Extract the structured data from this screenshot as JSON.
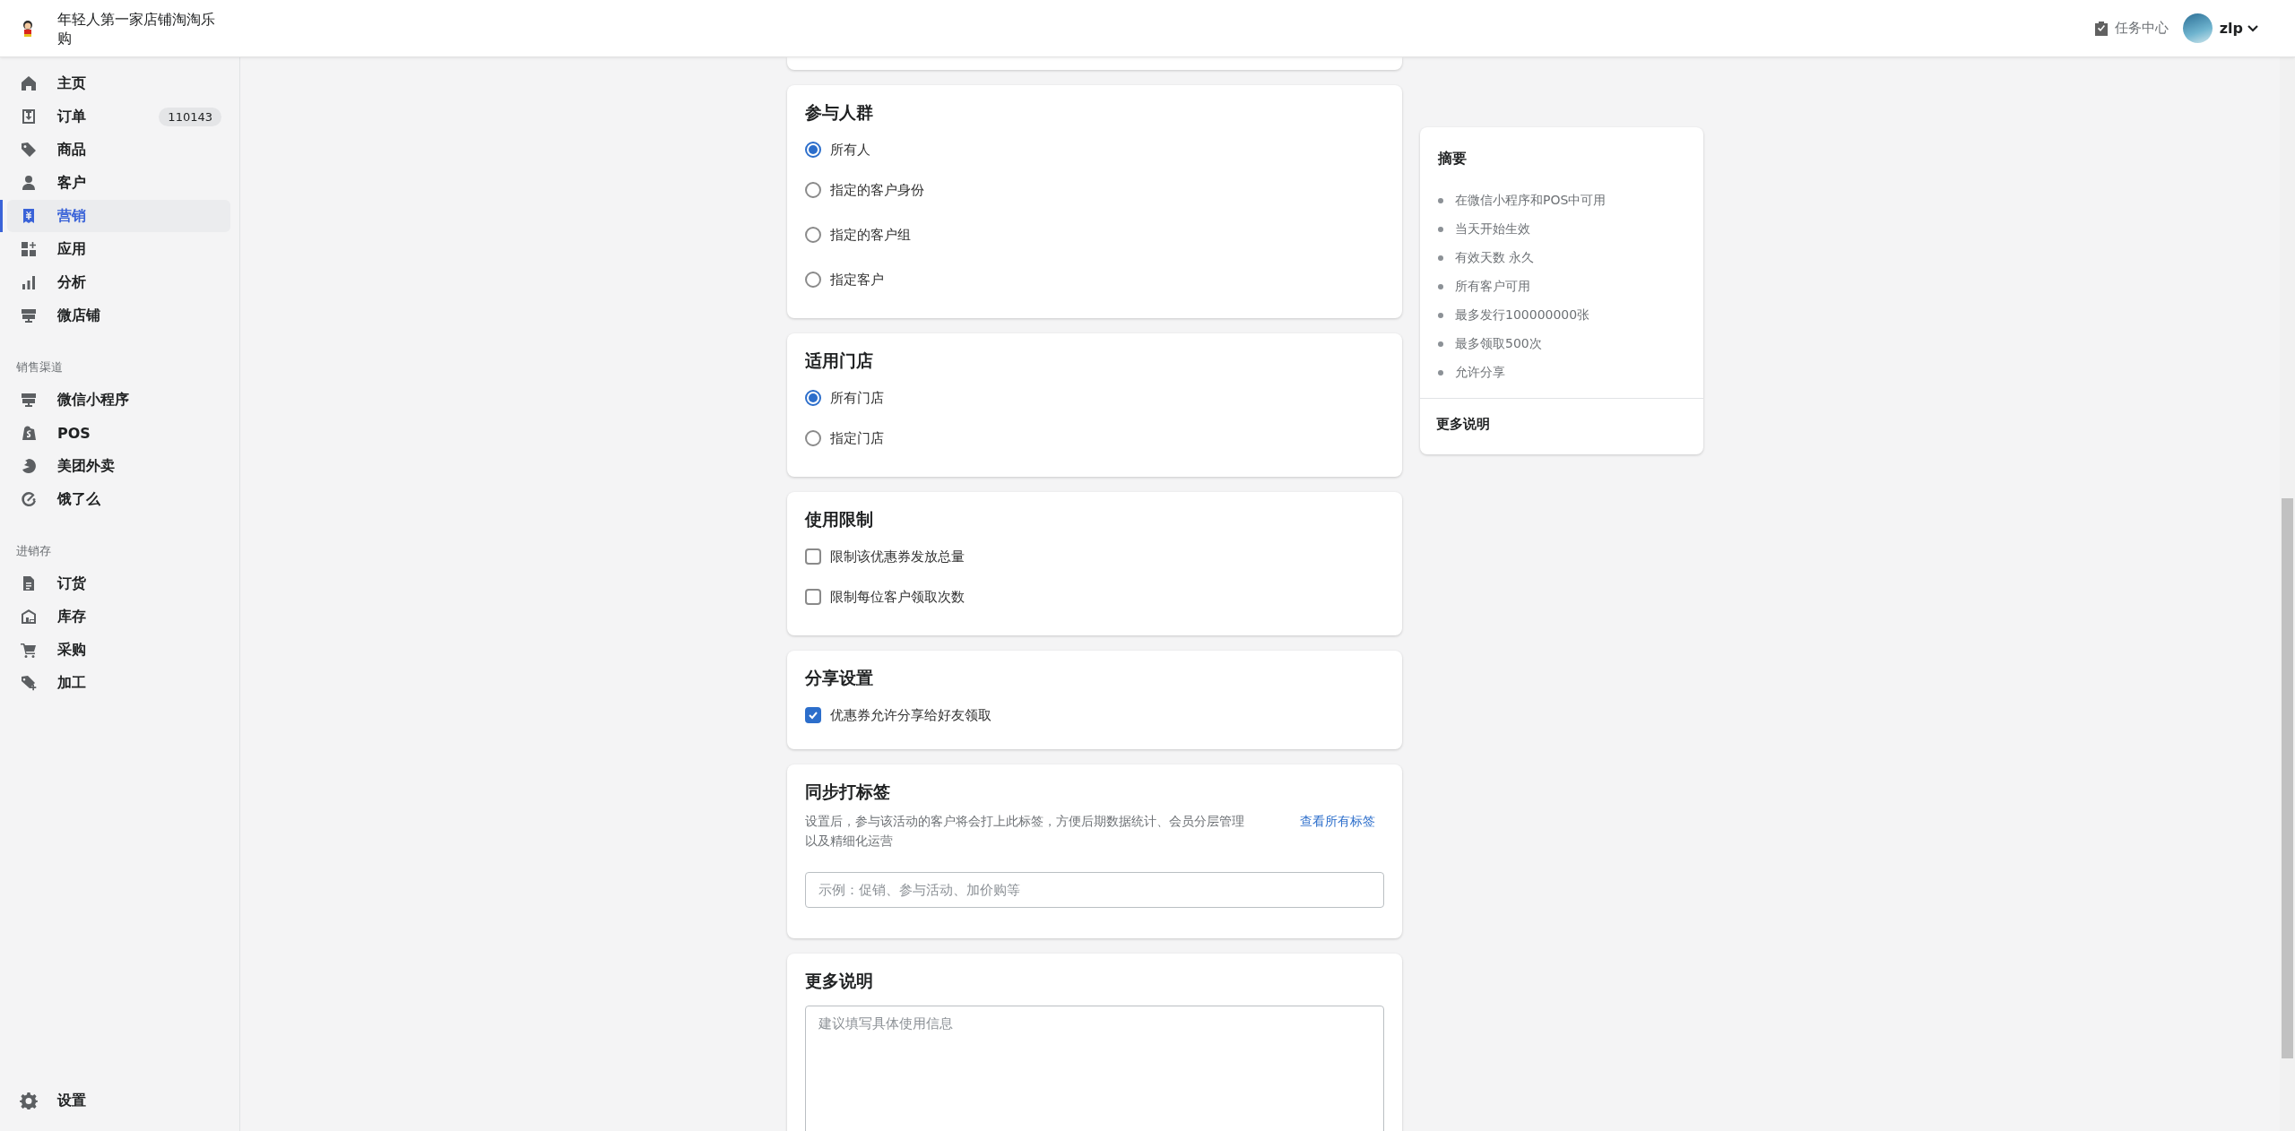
{
  "header": {
    "store_name": "年轻人第一家店铺淘淘乐购",
    "task_center": "任务中心",
    "user": "zlp"
  },
  "sidebar": {
    "groups": [
      {
        "items": [
          {
            "label": "主页",
            "selected": false
          },
          {
            "label": "订单",
            "badge": "110143",
            "selected": false
          },
          {
            "label": "商品",
            "selected": false
          },
          {
            "label": "客户",
            "selected": false
          },
          {
            "label": "营销",
            "selected": true
          },
          {
            "label": "应用",
            "selected": false
          },
          {
            "label": "分析",
            "selected": false
          },
          {
            "label": "微店铺",
            "selected": false
          }
        ]
      },
      {
        "title": "销售渠道",
        "items": [
          {
            "label": "微信小程序",
            "selected": false
          },
          {
            "label": "POS",
            "selected": false
          },
          {
            "label": "美团外卖",
            "selected": false
          },
          {
            "label": "饿了么",
            "selected": false
          }
        ]
      },
      {
        "title": "进销存",
        "items": [
          {
            "label": "订货",
            "selected": false
          },
          {
            "label": "库存",
            "selected": false
          },
          {
            "label": "采购",
            "selected": false
          },
          {
            "label": "加工",
            "selected": false
          }
        ]
      }
    ],
    "settings": "设置"
  },
  "cards": [
    {
      "kind": "radio",
      "title": "参与人群",
      "options": [
        {
          "label": "所有人",
          "selected": true
        },
        {
          "label": "指定的客户身份",
          "selected": false
        },
        {
          "label": "指定的客户组",
          "selected": false
        },
        {
          "label": "指定客户",
          "selected": false
        }
      ]
    },
    {
      "kind": "radio",
      "title": "适用门店",
      "options": [
        {
          "label": "所有门店",
          "selected": true
        },
        {
          "label": "指定门店",
          "selected": false
        }
      ]
    },
    {
      "kind": "checkbox",
      "title": "使用限制",
      "options": [
        {
          "label": "限制该优惠券发放总量",
          "checked": false
        },
        {
          "label": "限制每位客户领取次数",
          "checked": false
        }
      ]
    },
    {
      "kind": "checkbox",
      "title": "分享设置",
      "options": [
        {
          "label": "优惠券允许分享给好友领取",
          "checked": true
        }
      ]
    },
    {
      "kind": "tags",
      "title": "同步打标签",
      "description": "设置后，参与该活动的客户将会打上此标签，方便后期数据统计、会员分层管理以及精细化运营",
      "link": "查看所有标签",
      "placeholder": "示例：促销、参与活动、加价购等"
    },
    {
      "kind": "textarea",
      "title": "更多说明",
      "placeholder": "建议填写具体使用信息"
    }
  ],
  "summary": {
    "title": "摘要",
    "items": [
      "在微信小程序和POS中可用",
      "当天开始生效",
      "有效天数 永久",
      "所有客户可用",
      "最多发行100000000张",
      "最多领取500次",
      "允许分享"
    ],
    "footer": "更多说明"
  }
}
